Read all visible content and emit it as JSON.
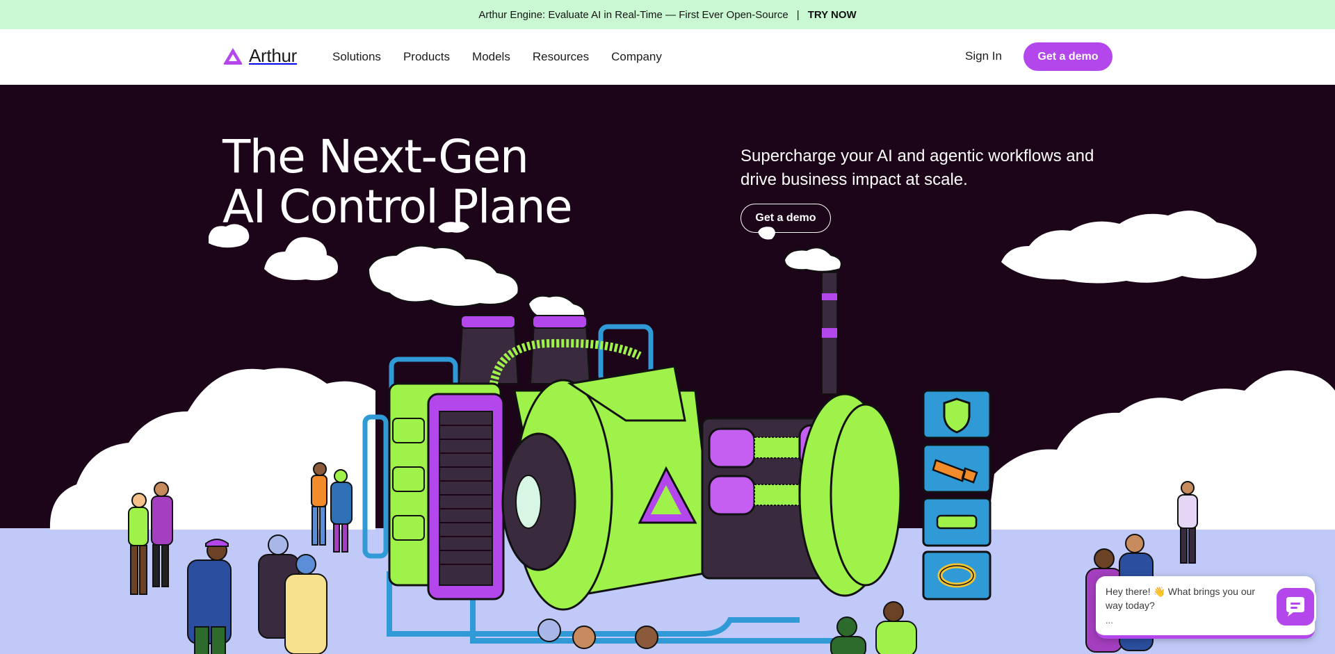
{
  "announcement": {
    "text": "Arthur Engine: Evaluate AI in Real-Time — First Ever Open-Source",
    "separator": "|",
    "cta": "TRY NOW"
  },
  "nav": {
    "logo_text": "Arthur",
    "menu": [
      "Solutions",
      "Products",
      "Models",
      "Resources",
      "Company"
    ],
    "sign_in": "Sign In",
    "demo_button": "Get a demo"
  },
  "hero": {
    "headline_line1": "The Next-Gen",
    "headline_line2": "AI Control Plane",
    "subhead": "Supercharge your AI and agentic workflows and drive business impact at scale.",
    "cta": "Get a demo"
  },
  "chat": {
    "message": "Hey there! 👋 What brings you our way today?",
    "typing": "..."
  },
  "colors": {
    "brand_purple": "#b447ec",
    "announce_bg": "#c9f8d3",
    "hero_bg": "#1c0519",
    "ground": "#c1c9f8",
    "machine_green": "#9ef24a"
  }
}
